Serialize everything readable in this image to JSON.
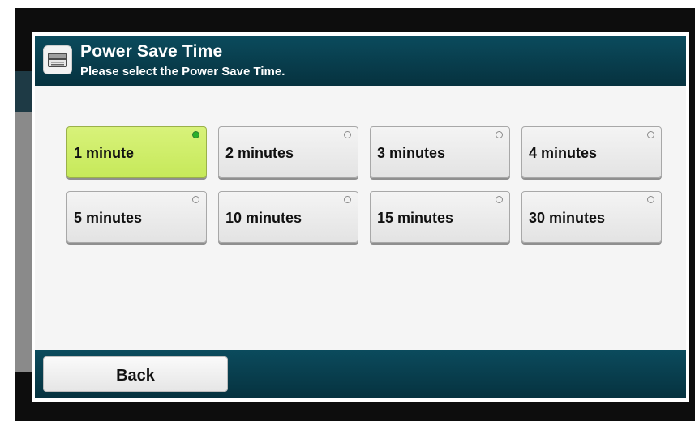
{
  "dialog": {
    "title": "Power Save Time",
    "subtitle": "Please select the Power Save Time.",
    "icon": "printer-panel-icon"
  },
  "options": [
    {
      "label": "1 minute",
      "selected": true
    },
    {
      "label": "2 minutes",
      "selected": false
    },
    {
      "label": "3 minutes",
      "selected": false
    },
    {
      "label": "4 minutes",
      "selected": false
    },
    {
      "label": "5 minutes",
      "selected": false
    },
    {
      "label": "10 minutes",
      "selected": false
    },
    {
      "label": "15 minutes",
      "selected": false
    },
    {
      "label": "30 minutes",
      "selected": false
    }
  ],
  "footer": {
    "back_label": "Back"
  },
  "colors": {
    "title_bar": "#0b4b5d",
    "selected": "#c6e95a",
    "indicator_on": "#2bb02b"
  }
}
